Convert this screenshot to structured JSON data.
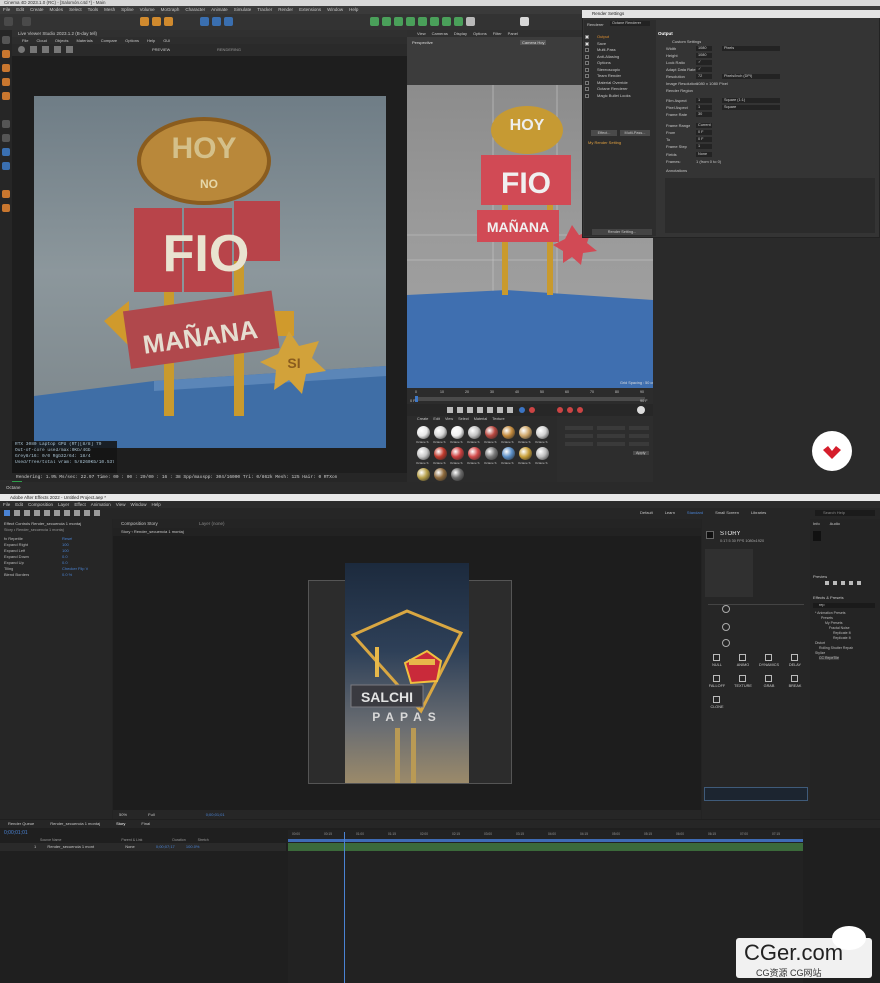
{
  "c4d": {
    "window_title": "Cinema 4D 2023.1.0 (RC) - [Salomón.c4d *] - Main",
    "menu": [
      "File",
      "Edit",
      "Create",
      "Modes",
      "Select",
      "Tools",
      "Mesh",
      "Spline",
      "Volume",
      "MoGraph",
      "Character",
      "Animate",
      "Simulate",
      "Tracker",
      "Render",
      "Extensions",
      "Window",
      "Help"
    ],
    "ipr": {
      "title": "Live Viewer Studio 2023.1.2 (B-day tell)",
      "menu": [
        "File",
        "Cloud",
        "Objects",
        "Materials",
        "Compare",
        "Options",
        "Help",
        "GUI"
      ],
      "render_mode": "PREVIEW",
      "status_label": "RENDERING",
      "stats": [
        "RTX 3080 Laptop GPU (RT)[8/8]    79",
        "Out-of-core used/max:0Kb/4Gb",
        "Grey8/16: 0/0          Rgb32/64: 18/4",
        "Used/free/total vram: 5/8260Kb/10.5370b/16Gb"
      ],
      "status_line": "Rendering: 1.9%   Ms/sec: 22.97   Time: 00 : 00 : 20/00 : 16 : 38   Spp/maxspp: 304/16000   Tri: 0/862k   Mesh: 125   Hair: 0    RTXon",
      "sign_words": [
        "HOY",
        "NO",
        "FIO",
        "MAÑANA",
        "SI"
      ]
    },
    "viewport": {
      "menu": [
        "View",
        "Cameras",
        "Display",
        "Options",
        "Filter",
        "Panel"
      ],
      "label": "Perspective",
      "camera": "Camera Hoy",
      "grid_spacing": "Grid Spacing : 50 cm"
    },
    "timeline": {
      "ticks": [
        "0",
        "10",
        "20",
        "30",
        "40",
        "50",
        "60",
        "70",
        "80",
        "90"
      ],
      "current": "0 F",
      "end": "90 F"
    },
    "material_manager": {
      "menu": [
        "Create",
        "Edit",
        "View",
        "Select",
        "Material",
        "Texture"
      ],
      "names": [
        "Octane S",
        "Octane S",
        "Octane S",
        "Octane S",
        "Octane S",
        "Octane S",
        "Octane S",
        "Octane S",
        "Octane S",
        "Octane S",
        "Octane S",
        "Octane S",
        "Octane S",
        "Octane S",
        "Octane S",
        "Octane S",
        "Octane S",
        "Octane S",
        "Octane S",
        "Octane S",
        "Octane S"
      ],
      "colors": [
        "#e8e8e8",
        "#d8d8d8",
        "#f2f2f2",
        "#c4c4c4",
        "#b8473f",
        "#c38a3c",
        "#cfa76a",
        "#d2d2d2",
        "#c8c8c8",
        "#c0392b",
        "#cc3e3e",
        "#d34a4a",
        "#7a7a7a",
        "#5b8fc7",
        "#c9a03a",
        "#bdbdbd",
        "#b7a04a",
        "#8e6a3c",
        "#6b6b6b"
      ],
      "apply_label": "Apply"
    },
    "render_settings": {
      "title": "Render Settings",
      "renderer_label": "Renderer",
      "renderer_value": "Octane Renderer",
      "items": [
        "Output",
        "Save",
        "Multi-Pass",
        "Anti-Aliasing",
        "Options",
        "Stereoscopic",
        "Team Render",
        "Material Override",
        "Octane Renderer",
        "Magic Bullet Looks"
      ],
      "section_title": "Output",
      "custom_settings": "Custom Settings",
      "fields": [
        {
          "label": "Width",
          "value": "1080",
          "unit": "Pixels"
        },
        {
          "label": "Height",
          "value": "1080"
        },
        {
          "label": "Lock Ratio",
          "value": "✓"
        },
        {
          "label": "Adapt Data Rate",
          "value": "✓"
        },
        {
          "label": "Resolution",
          "value": "72",
          "unit": "Pixels/Inch (DPI)"
        },
        {
          "label": "Image Resolution:",
          "value": "1080 x 1080 Pixel"
        },
        {
          "label": "Render Region",
          "value": ""
        },
        {
          "label": "Film Aspect",
          "value": "1",
          "unit": "Square (1:1)"
        },
        {
          "label": "Pixel Aspect",
          "value": "1",
          "unit": "Square"
        },
        {
          "label": "Frame Rate",
          "value": "30"
        },
        {
          "label": "Frame Range",
          "value": "Current Frame"
        },
        {
          "label": "From",
          "value": "0 F"
        },
        {
          "label": "To",
          "value": "0 F"
        },
        {
          "label": "Frame Step",
          "value": "1"
        },
        {
          "label": "Fields",
          "value": "None"
        },
        {
          "label": "Frames:",
          "value": "1 (from 0 to 0)"
        },
        {
          "label": "Annotations",
          "value": ""
        }
      ],
      "effect_button": "Effect...",
      "multi_pass_button": "Multi-Pass...",
      "my_setting": "My Render Setting",
      "footer_button": "Render Setting..."
    },
    "status_bar": "Octane"
  },
  "ae": {
    "window_title": "Adobe After Effects 2022 - Untitled Project.aep *",
    "menu": [
      "File",
      "Edit",
      "Composition",
      "Layer",
      "Effect",
      "Animation",
      "View",
      "Window",
      "Help"
    ],
    "workspaces": [
      "Default",
      "Learn",
      "Standard",
      "Small Screen",
      "Libraries"
    ],
    "search_placeholder": "Search Help",
    "fx_panel": {
      "tab": "Effect Controls Render_secuencia 1 montaj",
      "layer": "Story • Render_secuencia 1 montaj",
      "rows": [
        {
          "label": "fx  Repetile",
          "value": "Reset"
        },
        {
          "label": "Expand Right",
          "value": "100"
        },
        {
          "label": "Expand Left",
          "value": "100"
        },
        {
          "label": "Expand Down",
          "value": "0.0"
        },
        {
          "label": "Expand Up",
          "value": "0.0"
        },
        {
          "label": "Tiling",
          "value": "Checker Flip V"
        },
        {
          "label": "Blend Borders",
          "value": "0.0 %"
        }
      ]
    },
    "comp_panel": {
      "tab": "Composition Story",
      "subtab": "Story  ‹  Render_secuencia 1 montaj",
      "layer_tab": "Layer (none)",
      "zoom": "50%",
      "quality": "Full",
      "footer_time": "0;00;01;01",
      "sign_words": [
        "SALCHI",
        "PAPAS"
      ]
    },
    "story_panel": {
      "title": "STORY",
      "specs": "0:17:5  30 FPS  1080x1920",
      "tools": [
        "NULL",
        "ANIMO",
        "DYNAMICS",
        "DELAY",
        "FALLOFF",
        "TEXTURE",
        "GRAB",
        "BREAK",
        "CLONE"
      ]
    },
    "side_panel": {
      "tabs": [
        "Info",
        "Audio"
      ],
      "preview": "Preview",
      "effects": "Effects & Presets",
      "search_value": "rep",
      "tree": [
        "* Animation Presets",
        "Presets",
        "My Presets",
        "Fractal Noise",
        "Replicate M",
        "Replicate M",
        "Distort",
        "Rolling Shutter Repair",
        "Stylize",
        "CC RepeTile"
      ],
      "bottom_tabs": [
        "Paragraph",
        "Align"
      ]
    },
    "timeline": {
      "tabs": [
        "Render Queue",
        "Render_secuencia 1 montaj",
        "Story",
        "Final"
      ],
      "timecode": "0;00;01;01",
      "columns": [
        "Source Name",
        "Parent & Link",
        "Duration",
        "Stretch"
      ],
      "layer_num": "1",
      "layer_name": "Render_secuencia 1 mont",
      "parent": "None",
      "duration": "0;00;07;17",
      "stretch": "100.0%",
      "ticks": [
        "00:00",
        "00:15",
        "01:00",
        "01:15",
        "02:00",
        "02:15",
        "03:00",
        "03:15",
        "04:00",
        "04:15",
        "05:00",
        "05:15",
        "06:00",
        "06:15",
        "07:00",
        "07:15"
      ]
    }
  },
  "watermark": {
    "brand": "CGer.com",
    "sub": "CG资源  CG网站"
  }
}
